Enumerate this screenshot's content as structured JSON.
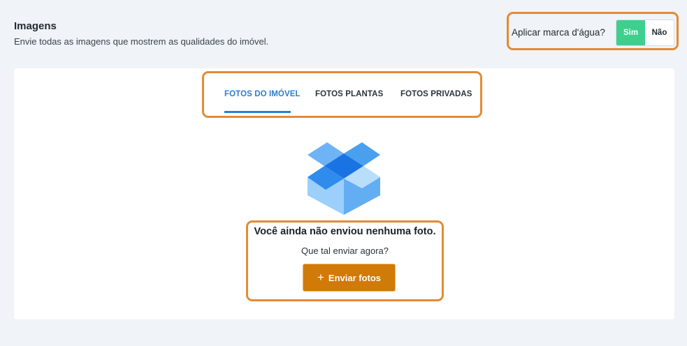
{
  "header": {
    "title": "Imagens",
    "subtitle": "Envie todas as imagens que mostrem as qualidades do imóvel."
  },
  "watermark": {
    "label": "Aplicar marca d'água?",
    "options": [
      "Sim",
      "Não"
    ],
    "selected": "Sim"
  },
  "tabs": [
    {
      "label": "FOTOS DO IMÓVEL",
      "active": true
    },
    {
      "label": "FOTOS PLANTAS",
      "active": false
    },
    {
      "label": "FOTOS PRIVADAS",
      "active": false
    }
  ],
  "empty_state": {
    "icon": "open-box-icon",
    "title": "Você ainda não enviou nenhuma foto.",
    "subtitle": "Que tal enviar agora?",
    "button_icon": "plus-icon",
    "button_label": "Enviar fotos"
  },
  "colors": {
    "background": "#f0f3f7",
    "accent_blue": "#2b7fd0",
    "toggle_on": "#3ecf8e",
    "button": "#d07a07",
    "highlight_outline": "#e48a36"
  }
}
